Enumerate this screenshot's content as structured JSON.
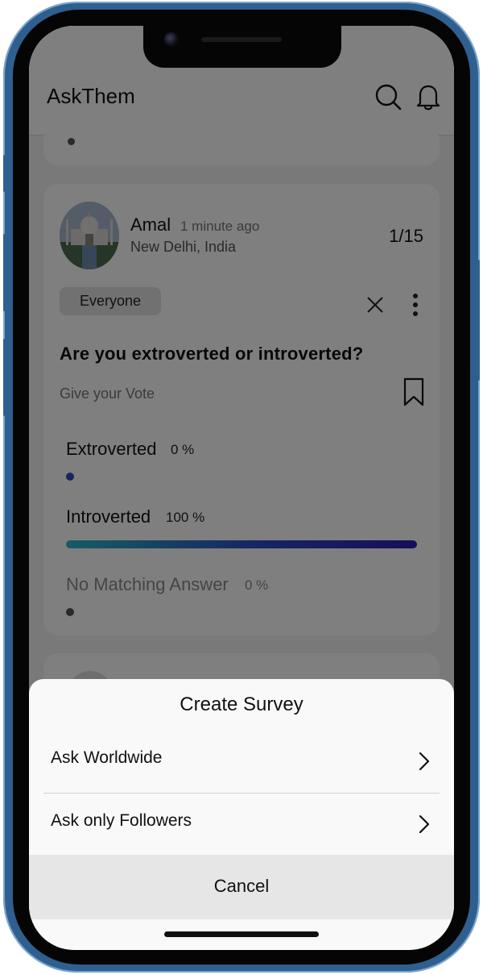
{
  "header": {
    "app_title": "AskThem",
    "search_icon": "search-icon",
    "bell_icon": "bell-icon"
  },
  "post": {
    "user_name": "Amal",
    "time": "1 minute ago",
    "location": "New Delhi, India",
    "page_count": "1/15",
    "audience": "Everyone",
    "question": "Are you extroverted or introverted?",
    "vote_hint": "Give your Vote",
    "options": [
      {
        "label": "Extroverted",
        "percent_label": "0 %",
        "percent": 0
      },
      {
        "label": "Introverted",
        "percent_label": "100 %",
        "percent": 100
      },
      {
        "label": "No Matching Answer",
        "percent_label": "0 %",
        "percent": 0
      }
    ]
  },
  "sheet": {
    "title": "Create Survey",
    "options": [
      {
        "label": "Ask Worldwide"
      },
      {
        "label": "Ask only Followers"
      }
    ],
    "cancel_label": "Cancel"
  },
  "colors": {
    "accent_start": "#2fb9c9",
    "accent_end": "#2e1db8",
    "dot_blue": "#2d4bc3"
  }
}
